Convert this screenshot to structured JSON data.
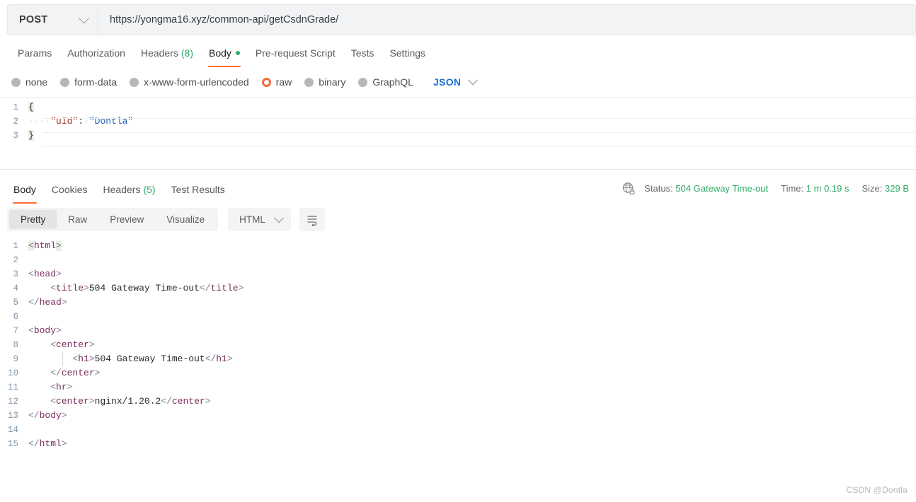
{
  "request": {
    "method": "POST",
    "url": "https://yongma16.xyz/common-api/getCsdnGrade/",
    "tabs": [
      {
        "label": "Params",
        "active": false
      },
      {
        "label": "Authorization",
        "active": false
      },
      {
        "label": "Headers",
        "count": "(8)",
        "active": false
      },
      {
        "label": "Body",
        "active": true,
        "dot": true
      },
      {
        "label": "Pre-request Script",
        "active": false
      },
      {
        "label": "Tests",
        "active": false
      },
      {
        "label": "Settings",
        "active": false
      }
    ],
    "body_types": [
      {
        "label": "none",
        "selected": false
      },
      {
        "label": "form-data",
        "selected": false
      },
      {
        "label": "x-www-form-urlencoded",
        "selected": false
      },
      {
        "label": "raw",
        "selected": true
      },
      {
        "label": "binary",
        "selected": false
      },
      {
        "label": "GraphQL",
        "selected": false
      }
    ],
    "raw_format": "JSON",
    "body_lines": [
      {
        "n": "1",
        "open_brace": "{"
      },
      {
        "n": "2",
        "indent": "····",
        "key": "\"uId\"",
        "colon": ":",
        "space": "·",
        "value": "\"Dontla\""
      },
      {
        "n": "3",
        "close_brace": "}"
      }
    ]
  },
  "response": {
    "tabs": [
      {
        "label": "Body",
        "active": true
      },
      {
        "label": "Cookies",
        "active": false
      },
      {
        "label": "Headers",
        "count": "(5)",
        "active": false
      },
      {
        "label": "Test Results",
        "active": false
      }
    ],
    "status": {
      "status_label": "Status:",
      "status_value": "504 Gateway Time-out",
      "time_label": "Time:",
      "time_value": "1 m 0.19 s",
      "size_label": "Size:",
      "size_value": "329 B",
      "icon": "globe-lock-icon"
    },
    "view_modes": [
      {
        "label": "Pretty",
        "active": true
      },
      {
        "label": "Raw",
        "active": false
      },
      {
        "label": "Preview",
        "active": false
      },
      {
        "label": "Visualize",
        "active": false
      }
    ],
    "format": "HTML",
    "wrap_icon": "word-wrap-icon",
    "body_lines": [
      {
        "n": "1",
        "parts": [
          {
            "t": "<",
            "c": "brk-ang"
          },
          {
            "t": "html",
            "c": "tag"
          },
          {
            "t": ">",
            "c": "brk-ang"
          }
        ]
      },
      {
        "n": "2",
        "parts": []
      },
      {
        "n": "3",
        "parts": [
          {
            "t": "<",
            "c": "ang"
          },
          {
            "t": "head",
            "c": "tag"
          },
          {
            "t": ">",
            "c": "ang"
          }
        ]
      },
      {
        "n": "4",
        "parts": [
          {
            "t": "    ",
            "c": "txt"
          },
          {
            "t": "<",
            "c": "ang"
          },
          {
            "t": "title",
            "c": "tag"
          },
          {
            "t": ">",
            "c": "ang"
          },
          {
            "t": "504 Gateway Time-out",
            "c": "txt"
          },
          {
            "t": "</",
            "c": "ang"
          },
          {
            "t": "title",
            "c": "tag"
          },
          {
            "t": ">",
            "c": "ang"
          }
        ]
      },
      {
        "n": "5",
        "parts": [
          {
            "t": "</",
            "c": "ang"
          },
          {
            "t": "head",
            "c": "tag"
          },
          {
            "t": ">",
            "c": "ang"
          }
        ]
      },
      {
        "n": "6",
        "parts": []
      },
      {
        "n": "7",
        "parts": [
          {
            "t": "<",
            "c": "ang"
          },
          {
            "t": "body",
            "c": "tag"
          },
          {
            "t": ">",
            "c": "ang"
          }
        ]
      },
      {
        "n": "8",
        "parts": [
          {
            "t": "    ",
            "c": "txt"
          },
          {
            "t": "<",
            "c": "ang"
          },
          {
            "t": "center",
            "c": "tag"
          },
          {
            "t": ">",
            "c": "ang"
          }
        ]
      },
      {
        "n": "9",
        "parts": [
          {
            "t": "        ",
            "c": "txt"
          },
          {
            "t": "<",
            "c": "ang"
          },
          {
            "t": "h1",
            "c": "tag"
          },
          {
            "t": ">",
            "c": "ang"
          },
          {
            "t": "504 Gateway Time-out",
            "c": "txt"
          },
          {
            "t": "</",
            "c": "ang"
          },
          {
            "t": "h1",
            "c": "tag"
          },
          {
            "t": ">",
            "c": "ang"
          }
        ]
      },
      {
        "n": "10",
        "parts": [
          {
            "t": "    ",
            "c": "txt"
          },
          {
            "t": "</",
            "c": "ang"
          },
          {
            "t": "center",
            "c": "tag"
          },
          {
            "t": ">",
            "c": "ang"
          }
        ]
      },
      {
        "n": "11",
        "parts": [
          {
            "t": "    ",
            "c": "txt"
          },
          {
            "t": "<",
            "c": "ang"
          },
          {
            "t": "hr",
            "c": "tag"
          },
          {
            "t": ">",
            "c": "ang"
          }
        ]
      },
      {
        "n": "12",
        "parts": [
          {
            "t": "    ",
            "c": "txt"
          },
          {
            "t": "<",
            "c": "ang"
          },
          {
            "t": "center",
            "c": "tag"
          },
          {
            "t": ">",
            "c": "ang"
          },
          {
            "t": "nginx/1.20.2",
            "c": "txt"
          },
          {
            "t": "</",
            "c": "ang"
          },
          {
            "t": "center",
            "c": "tag"
          },
          {
            "t": ">",
            "c": "ang"
          }
        ]
      },
      {
        "n": "13",
        "parts": [
          {
            "t": "</",
            "c": "ang"
          },
          {
            "t": "body",
            "c": "tag"
          },
          {
            "t": ">",
            "c": "ang"
          }
        ]
      },
      {
        "n": "14",
        "parts": []
      },
      {
        "n": "15",
        "parts": [
          {
            "t": "</",
            "c": "ang"
          },
          {
            "t": "html",
            "c": "tag"
          },
          {
            "t": ">",
            "c": "ang"
          }
        ]
      }
    ]
  },
  "watermark": "CSDN @Dontla",
  "colors": {
    "accent_orange": "#ff6c37",
    "status_green": "#2fa964",
    "link_blue": "#1a6fd4"
  }
}
